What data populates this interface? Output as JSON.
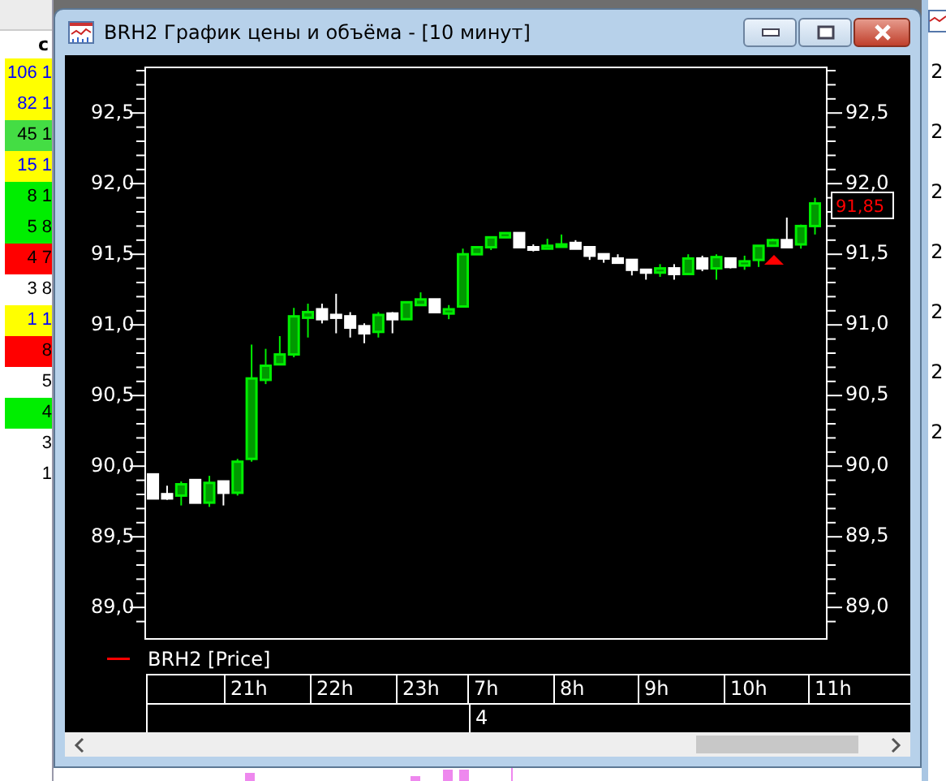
{
  "left_table": {
    "header": "с",
    "rows": [
      {
        "value": "106 1",
        "color": "#ffff00",
        "kind": "highlight"
      },
      {
        "value": "82 1",
        "color": "#ffff00",
        "kind": "highlight"
      },
      {
        "value": "45 1",
        "color": "#44dd44",
        "kind": "plain"
      },
      {
        "value": "15 1",
        "color": "#ffff00",
        "kind": "highlight"
      },
      {
        "value": "8 1",
        "color": "#00ee00",
        "kind": "plain"
      },
      {
        "value": "5 8",
        "color": "#00ee00",
        "kind": "plain"
      },
      {
        "value": "4 7",
        "color": "#ff0000",
        "kind": "plain"
      },
      {
        "value": "3 8",
        "color": "#ffffff",
        "kind": "plain"
      },
      {
        "value": "1 1",
        "color": "#ffff00",
        "kind": "highlight"
      },
      {
        "value": "8",
        "color": "#ff0000",
        "kind": "plain"
      },
      {
        "value": "5",
        "color": "#ffffff",
        "kind": "plain"
      },
      {
        "value": "4",
        "color": "#00ee00",
        "kind": "plain"
      },
      {
        "value": "3",
        "color": "#ffffff",
        "kind": "plain"
      },
      {
        "value": "1",
        "color": "#ffffff",
        "kind": "plain"
      }
    ]
  },
  "window": {
    "title": "BRH2 График цены и объёма - [10 минут]"
  },
  "chart": {
    "left_axis_labels": [
      "92,5",
      "92,0",
      "91,5",
      "91,0",
      "90,5",
      "90,0",
      "89,5",
      "89,0"
    ],
    "last_price": "91,85",
    "chart_data": {
      "type": "candlestick",
      "ylim": [
        88.77,
        92.82
      ],
      "yticks": [
        {
          "value": 92.5,
          "label": "92,5"
        },
        {
          "value": 92.0,
          "label": "92,0"
        },
        {
          "value": 91.5,
          "label": "91,5"
        },
        {
          "value": 91.0,
          "label": "91,0"
        },
        {
          "value": 90.5,
          "label": "90,5"
        },
        {
          "value": 90.0,
          "label": "90,0"
        },
        {
          "value": 89.5,
          "label": "89,5"
        },
        {
          "value": 89.0,
          "label": "89,0"
        }
      ],
      "ohlc": [
        [
          89.93,
          89.93,
          89.76,
          89.76
        ],
        [
          89.79,
          89.85,
          89.75,
          89.76
        ],
        [
          89.78,
          89.88,
          89.71,
          89.86
        ],
        [
          89.89,
          89.89,
          89.73,
          89.73
        ],
        [
          89.73,
          89.92,
          89.7,
          89.87
        ],
        [
          89.88,
          89.88,
          89.71,
          89.8
        ],
        [
          89.8,
          90.04,
          89.78,
          90.02
        ],
        [
          90.04,
          90.85,
          90.02,
          90.61
        ],
        [
          90.6,
          90.82,
          90.57,
          90.7
        ],
        [
          90.71,
          90.91,
          90.71,
          90.78
        ],
        [
          90.78,
          91.11,
          90.76,
          91.05
        ],
        [
          91.04,
          91.14,
          90.9,
          91.08
        ],
        [
          91.1,
          91.14,
          91.0,
          91.03
        ],
        [
          91.06,
          91.21,
          90.93,
          91.04
        ],
        [
          91.05,
          91.08,
          90.9,
          90.97
        ],
        [
          90.98,
          91.0,
          90.86,
          90.93
        ],
        [
          90.94,
          91.08,
          90.9,
          91.06
        ],
        [
          91.07,
          91.08,
          90.93,
          91.03
        ],
        [
          91.03,
          91.15,
          91.03,
          91.15
        ],
        [
          91.13,
          91.22,
          91.13,
          91.17
        ],
        [
          91.17,
          91.17,
          91.08,
          91.08
        ],
        [
          91.07,
          91.13,
          91.03,
          91.1
        ],
        [
          91.12,
          91.53,
          91.12,
          91.49
        ],
        [
          91.49,
          91.54,
          91.49,
          91.54
        ],
        [
          91.54,
          91.61,
          91.52,
          91.61
        ],
        [
          91.61,
          91.64,
          91.61,
          91.64
        ],
        [
          91.64,
          91.64,
          91.54,
          91.54
        ],
        [
          91.54,
          91.56,
          91.51,
          91.53
        ],
        [
          91.53,
          91.6,
          91.53,
          91.55
        ],
        [
          91.55,
          91.63,
          91.55,
          91.56
        ],
        [
          91.57,
          91.59,
          91.53,
          91.53
        ],
        [
          91.54,
          91.54,
          91.45,
          91.48
        ],
        [
          91.49,
          91.49,
          91.43,
          91.46
        ],
        [
          91.46,
          91.49,
          91.43,
          91.43
        ],
        [
          91.45,
          91.45,
          91.34,
          91.38
        ],
        [
          91.38,
          91.38,
          91.31,
          91.36
        ],
        [
          91.36,
          91.42,
          91.33,
          91.39
        ],
        [
          91.39,
          91.42,
          91.31,
          91.35
        ],
        [
          91.35,
          91.49,
          91.35,
          91.46
        ],
        [
          91.46,
          91.48,
          91.37,
          91.39
        ],
        [
          91.39,
          91.49,
          91.31,
          91.47
        ],
        [
          91.46,
          91.46,
          91.39,
          91.4
        ],
        [
          91.41,
          91.48,
          91.38,
          91.44
        ],
        [
          91.45,
          91.55,
          91.4,
          91.55
        ],
        [
          91.55,
          91.6,
          91.55,
          91.59
        ],
        [
          91.59,
          91.75,
          91.54,
          91.54
        ],
        [
          91.56,
          91.7,
          91.53,
          91.69
        ],
        [
          91.69,
          91.89,
          91.63,
          91.85
        ]
      ]
    },
    "legend": "BRH2 [Price]",
    "hours": [
      "21h",
      "22h",
      "23h",
      "7h",
      "8h",
      "9h",
      "10h",
      "11h"
    ],
    "day": "4"
  },
  "right_strip": {
    "labels": [
      "2",
      "2",
      "2",
      "2",
      "2",
      "2",
      "2"
    ]
  }
}
